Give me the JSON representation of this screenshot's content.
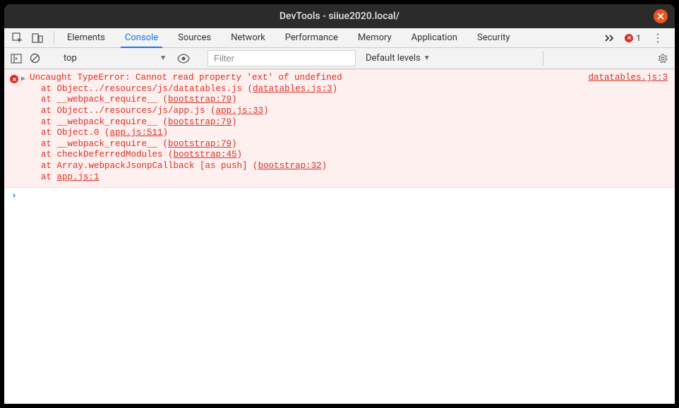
{
  "window": {
    "title": "DevTools - siiue2020.local/"
  },
  "tabs": {
    "items": [
      {
        "label": "Elements"
      },
      {
        "label": "Console"
      },
      {
        "label": "Sources"
      },
      {
        "label": "Network"
      },
      {
        "label": "Performance"
      },
      {
        "label": "Memory"
      },
      {
        "label": "Application"
      },
      {
        "label": "Security"
      }
    ],
    "active": "Console",
    "error_count": "1"
  },
  "toolbar": {
    "context": "top",
    "filter_placeholder": "Filter",
    "levels_label": "Default levels"
  },
  "error": {
    "message": "Uncaught TypeError: Cannot read property 'ext' of undefined",
    "source": "datatables.js:3",
    "stack": [
      {
        "prefix": "at Object../resources/js/datatables.js (",
        "link": "datatables.js:3",
        "suffix": ")"
      },
      {
        "prefix": "at __webpack_require__ (",
        "link": "bootstrap:79",
        "suffix": ")"
      },
      {
        "prefix": "at Object../resources/js/app.js (",
        "link": "app.js:33",
        "suffix": ")"
      },
      {
        "prefix": "at __webpack_require__ (",
        "link": "bootstrap:79",
        "suffix": ")"
      },
      {
        "prefix": "at Object.0 (",
        "link": "app.js:511",
        "suffix": ")"
      },
      {
        "prefix": "at __webpack_require__ (",
        "link": "bootstrap:79",
        "suffix": ")"
      },
      {
        "prefix": "at checkDeferredModules (",
        "link": "bootstrap:45",
        "suffix": ")"
      },
      {
        "prefix": "at Array.webpackJsonpCallback [as push] (",
        "link": "bootstrap:32",
        "suffix": ")"
      },
      {
        "prefix": "at ",
        "link": "app.js:1",
        "suffix": ""
      }
    ]
  }
}
